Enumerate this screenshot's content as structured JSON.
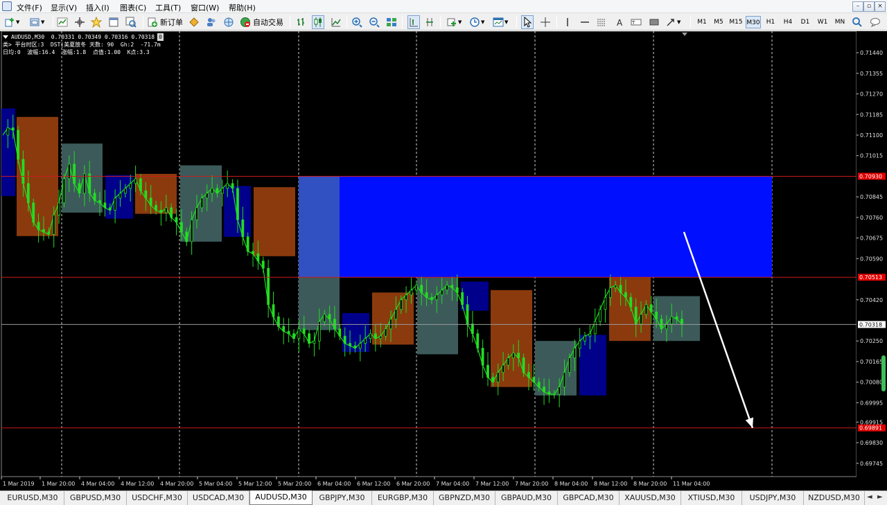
{
  "menu": {
    "items": [
      "文件(F)",
      "显示(V)",
      "插入(I)",
      "图表(C)",
      "工具(T)",
      "窗口(W)",
      "帮助(H)"
    ],
    "window_buttons": [
      "–",
      "▫",
      "×"
    ]
  },
  "toolbar": {
    "new_order_label": "新订单",
    "auto_trading_label": "自动交易",
    "timeframes": [
      "M1",
      "M5",
      "M15",
      "M30",
      "H1",
      "H4",
      "D1",
      "W1",
      "MN"
    ],
    "active_timeframe": "M30"
  },
  "chart_info": {
    "line1": "AUDUSD,M30  0.70331 0.70349 0.70316 0.70318",
    "line2": "类> 平台时区:3  DST|美夏放冬 天数: 90  Gh:2  -71.7m",
    "line3": "日均:0  波幅:16.4  涨幅:1.8  点值:1.00  K点:3.3",
    "badge": "0"
  },
  "chart_data": {
    "type": "candlestick",
    "symbol": "AUDUSD",
    "timeframe": "M30",
    "price_axis_ticks": [
      "0.71440",
      "0.71355",
      "0.71270",
      "0.71185",
      "0.71100",
      "0.71015",
      "0.70845",
      "0.70760",
      "0.70675",
      "0.70590",
      "0.70420",
      "0.70250",
      "0.70165",
      "0.70080",
      "0.69995",
      "0.69915",
      "0.69830",
      "0.69745"
    ],
    "price_labels": [
      {
        "text": "0.70930",
        "color": "#e00000"
      },
      {
        "text": "0.70513",
        "color": "#e00000"
      },
      {
        "text": "0.70318",
        "color": "#ffffff"
      },
      {
        "text": "0.69891",
        "color": "#e00000"
      }
    ],
    "time_axis_ticks": [
      "1 Mar 2019",
      "1 Mar 20:00",
      "4 Mar 04:00",
      "4 Mar 12:00",
      "4 Mar 20:00",
      "5 Mar 04:00",
      "5 Mar 12:00",
      "5 Mar 20:00",
      "6 Mar 04:00",
      "6 Mar 12:00",
      "6 Mar 20:00",
      "7 Mar 04:00",
      "7 Mar 12:00",
      "7 Mar 20:00",
      "8 Mar 04:00",
      "8 Mar 12:00",
      "8 Mar 20:00",
      "11 Mar 04:00"
    ],
    "horizontal_lines": [
      0.7093,
      0.70513,
      0.69891
    ],
    "current_price": 0.70318,
    "zone": {
      "high": 0.7093,
      "low": 0.70513,
      "color": "#0010ff"
    },
    "session_boxes": [
      {
        "high": 0.7121,
        "low": 0.70848,
        "color": "#00008b"
      },
      {
        "high": 0.71175,
        "low": 0.70683,
        "color": "#8b3a0e"
      },
      {
        "high": 0.71065,
        "low": 0.7078,
        "color": "#3c5a5a"
      },
      {
        "high": 0.70935,
        "low": 0.70755,
        "color": "#00008b"
      },
      {
        "high": 0.7094,
        "low": 0.70775,
        "color": "#8b3a0e"
      },
      {
        "high": 0.70975,
        "low": 0.7066,
        "color": "#3c5a5a"
      },
      {
        "high": 0.7089,
        "low": 0.7068,
        "color": "#00008b"
      },
      {
        "high": 0.70885,
        "low": 0.706,
        "color": "#8b3a0e"
      },
      {
        "high": 0.7093,
        "low": 0.70295,
        "color": "#3c5a5a"
      },
      {
        "high": 0.70365,
        "low": 0.70205,
        "color": "#00008b"
      },
      {
        "high": 0.7045,
        "low": 0.70235,
        "color": "#8b3a0e"
      },
      {
        "high": 0.70513,
        "low": 0.70195,
        "color": "#3c5a5a"
      },
      {
        "high": 0.70495,
        "low": 0.70375,
        "color": "#00008b"
      },
      {
        "high": 0.7046,
        "low": 0.7006,
        "color": "#8b3a0e"
      },
      {
        "high": 0.7025,
        "low": 0.70025,
        "color": "#3c5a5a"
      },
      {
        "high": 0.70275,
        "low": 0.70025,
        "color": "#00008b"
      },
      {
        "high": 0.70513,
        "low": 0.7025,
        "color": "#8b3a0e"
      },
      {
        "high": 0.70435,
        "low": 0.7025,
        "color": "#3c5a5a"
      }
    ],
    "arrow": {
      "from": 0.707,
      "to": 0.69891,
      "color": "#ffffff"
    },
    "price_path": [
      0.711,
      0.7113,
      0.7112,
      0.71,
      0.709,
      0.7082,
      0.7074,
      0.7071,
      0.707,
      0.7069,
      0.7077,
      0.7082,
      0.7092,
      0.7098,
      0.709,
      0.7086,
      0.7094,
      0.7086,
      0.7083,
      0.7082,
      0.708,
      0.7079,
      0.7084,
      0.7086,
      0.7088,
      0.709,
      0.7092,
      0.7087,
      0.7084,
      0.7081,
      0.7079,
      0.7078,
      0.708,
      0.7076,
      0.7074,
      0.707,
      0.7066,
      0.7075,
      0.708,
      0.7084,
      0.7086,
      0.7088,
      0.7086,
      0.7088,
      0.709,
      0.7088,
      0.7075,
      0.7068,
      0.7062,
      0.7061,
      0.7058,
      0.7055,
      0.704,
      0.7035,
      0.7031,
      0.7029,
      0.7028,
      0.7026,
      0.703,
      0.7028,
      0.7024,
      0.7025,
      0.7033,
      0.7036,
      0.7034,
      0.703,
      0.7027,
      0.7024,
      0.7023,
      0.7022,
      0.7024,
      0.7026,
      0.7028,
      0.7026,
      0.7027,
      0.703,
      0.7034,
      0.7038,
      0.7042,
      0.7044,
      0.7046,
      0.7048,
      0.7045,
      0.7043,
      0.7042,
      0.7044,
      0.7046,
      0.7048,
      0.7047,
      0.7045,
      0.704,
      0.7032,
      0.7028,
      0.7022,
      0.7015,
      0.701,
      0.7008,
      0.7012,
      0.7015,
      0.7018,
      0.702,
      0.7018,
      0.7012,
      0.701,
      0.7008,
      0.7006,
      0.7004,
      0.7003,
      0.7003,
      0.7006,
      0.7012,
      0.7018,
      0.7022,
      0.7025,
      0.7027,
      0.7028,
      0.7033,
      0.7038,
      0.7043,
      0.7047,
      0.7048,
      0.7045,
      0.7043,
      0.7039,
      0.7032,
      0.7036,
      0.704,
      0.7037,
      0.7034,
      0.703,
      0.7032,
      0.7035,
      0.7034,
      0.7032
    ]
  },
  "symbol_tabs": [
    "EURUSD,M30",
    "GBPUSD,M30",
    "USDCHF,M30",
    "USDCAD,M30",
    "AUDUSD,M30",
    "GBPJPY,M30",
    "EURGBP,M30",
    "GBPNZD,M30",
    "GBPAUD,M30",
    "GBPCAD,M30",
    "XAUUSD,M30",
    "XTIUSD,M30",
    "USDJPY,M30",
    "NZDUSD,M30"
  ],
  "active_tab": "AUDUSD,M30"
}
